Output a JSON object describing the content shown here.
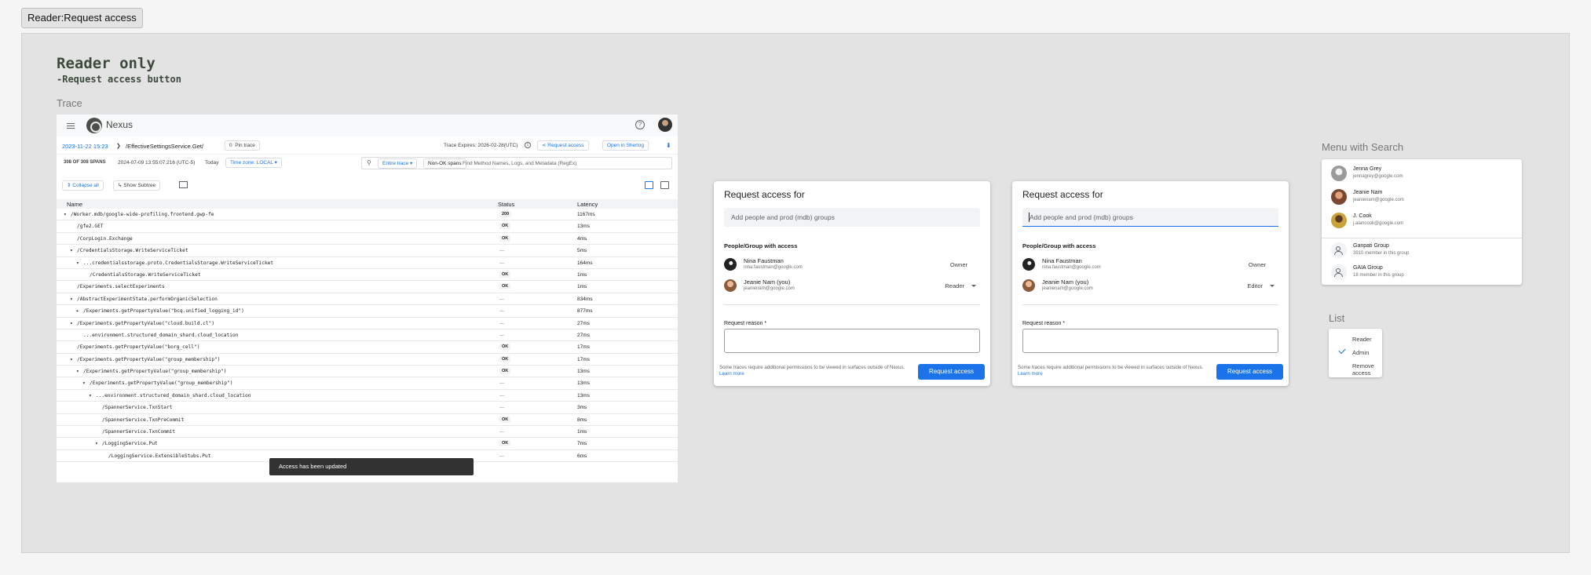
{
  "frame": {
    "label": "Reader:Request access"
  },
  "heading": {
    "title": "Reader only",
    "subtitle": "-Request access button"
  },
  "sections": {
    "trace": "Trace",
    "menu": "Menu with Search",
    "list": "List"
  },
  "trace": {
    "app_name": "Nexus",
    "help_glyph": "?",
    "breadcrumb_date": "2023-11-22 15:23",
    "breadcrumb_sep": "❯",
    "breadcrumb_path": "/EffectiveSettingsService.Get/",
    "pin_label": "Pin trace",
    "pin_glyph": "0",
    "expiry": "Trace Expires: 2026-02-28(UTC)",
    "info_glyph": "i",
    "request_access": "Request access",
    "open_sherlog": "Open in Sherlog",
    "spans_count": "308 OF 308 SPANS",
    "date_range": "2024-07-09 13:55:07.216 (UTC-5)",
    "today": "Today",
    "timezone": "Time zone: LOCAL",
    "entire_trace": "Entire trace",
    "non_ok": "Non-OK spans",
    "search_placeholder": "Find Method Names, Logs, and Metadata (RegEx)",
    "collapse_all": "Collapse all",
    "show_subtree": "Show Subtree",
    "columns": {
      "name": "Name",
      "status": "Status",
      "latency": "Latency"
    },
    "rows": [
      {
        "name": "/Worker.mdb/google-wide-profiling.frontend.gwp-fe",
        "status": "200",
        "latency": "1167ms",
        "arrow": "▾",
        "indent": 1
      },
      {
        "name": "/gfe2.GET",
        "status": "OK",
        "latency": "13ms",
        "arrow": "",
        "indent": 2
      },
      {
        "name": "/CorpLogin.Exchange",
        "status": "OK",
        "latency": "4ms",
        "arrow": "",
        "indent": 2
      },
      {
        "name": "/CredentialsStorage.WriteServiceTicket",
        "status": "---",
        "latency": "5ms",
        "arrow": "▾",
        "indent": 2
      },
      {
        "name": "...credentialsstorage.proto.CredentialsStorage.WriteServiceTicket",
        "status": "---",
        "latency": "164ms",
        "arrow": "▾",
        "indent": 3
      },
      {
        "name": "/CredentialsStorage.WriteServiceTicket",
        "status": "OK",
        "latency": "1ms",
        "arrow": "",
        "indent": 4
      },
      {
        "name": "/Experiments.selectExperiments",
        "status": "OK",
        "latency": "1ms",
        "arrow": "",
        "indent": 2
      },
      {
        "name": "/AbstractExperimentState.performOrganicSelection",
        "status": "---",
        "latency": "834ms",
        "arrow": "▾",
        "indent": 2
      },
      {
        "name": "/Experiments.getPropertyValue(\"bcq.unified_logging_id\")",
        "status": "---",
        "latency": "877ms",
        "arrow": "▸",
        "indent": 3
      },
      {
        "name": "/Experiments.getPropertyValue(\"cloud.build.cl\")",
        "status": "---",
        "latency": "27ms",
        "arrow": "▾",
        "indent": 2
      },
      {
        "name": "...environment.structured_domain_shard.cloud_location",
        "status": "---",
        "latency": "27ms",
        "arrow": "",
        "indent": 3
      },
      {
        "name": "/Experiments.getPropertyValue(\"borg_cell\")",
        "status": "OK",
        "latency": "17ms",
        "arrow": "",
        "indent": 2
      },
      {
        "name": "/Experiments.getPropertyValue(\"group_membership\")",
        "status": "OK",
        "latency": "17ms",
        "arrow": "▾",
        "indent": 2
      },
      {
        "name": "/Experiments.getPropertyValue(\"group_membership\")",
        "status": "OK",
        "latency": "13ms",
        "arrow": "▾",
        "indent": 3
      },
      {
        "name": "/Experiments.getPropertyValue(\"group_membership\")",
        "status": "---",
        "latency": "13ms",
        "arrow": "▾",
        "indent": 4
      },
      {
        "name": "...environment.structured_domain_shard.cloud_location",
        "status": "---",
        "latency": "13ms",
        "arrow": "▾",
        "indent": 5
      },
      {
        "name": "/SpannerService.TxnStart",
        "status": "---",
        "latency": "3ms",
        "arrow": "",
        "indent": 6
      },
      {
        "name": "/SpannerService.TxnPreCommit",
        "status": "OK",
        "latency": "8ms",
        "arrow": "",
        "indent": 6
      },
      {
        "name": "/SpannerService.TxnCommit",
        "status": "---",
        "latency": "1ms",
        "arrow": "",
        "indent": 6
      },
      {
        "name": "/LoggingService.Put",
        "status": "OK",
        "latency": "7ms",
        "arrow": "▾",
        "indent": 6
      },
      {
        "name": "/LoggingService.ExtensibleStubs.Put",
        "status": "---",
        "latency": "6ms",
        "arrow": "",
        "indent": 7
      }
    ],
    "toast": "Access has been updated"
  },
  "dialogs": [
    {
      "title": "Request access for",
      "input_placeholder": "Add people and prod (mdb) groups",
      "subheading": "People/Group with access",
      "people": [
        {
          "name": "Nina Faustman",
          "email": "nina.faustman@google.com",
          "role": "Owner"
        },
        {
          "name": "Jeanie Nam (you)",
          "email": "jeanienam@google.com",
          "role": "Reader"
        }
      ],
      "reason_label": "Request reason *",
      "note": "Some traces require additional permissions to be viewed in surfaces outside of Nexus.",
      "learn_more": "Learn more",
      "button": "Request access"
    },
    {
      "title": "Request access for",
      "input_placeholder": "Add people and prod (mdb) groups",
      "subheading": "People/Group with access",
      "people": [
        {
          "name": "Nina Faustman",
          "email": "nina.faustman@google.com",
          "role": "Owner"
        },
        {
          "name": "Jeanie Nam (you)",
          "email": "jeanienam@google.com",
          "role": "Editor"
        }
      ],
      "reason_label": "Request reason *",
      "note": "Some traces require additional permissions to be viewed in surfaces outside of Nexus.",
      "learn_more": "Learn more",
      "button": "Request access"
    }
  ],
  "menu": {
    "items": [
      {
        "name": "Jenna Grey",
        "detail": "jennagrey@google.com"
      },
      {
        "name": "Jeanie Nam",
        "detail": "jeanienam@google.com"
      },
      {
        "name": "J. Cook",
        "detail": "j.alancook@google.com"
      },
      {
        "name": "Ganpati Group",
        "detail": "3910 member in this group"
      },
      {
        "name": "GAIA Group",
        "detail": "18 member in this group"
      }
    ]
  },
  "list": {
    "items": [
      "Reader",
      "Admin",
      "Remove access"
    ],
    "selected": "Admin"
  },
  "colors": {
    "accent": "#1a73e8",
    "board": "#e3e3e3",
    "toast": "#323232"
  }
}
